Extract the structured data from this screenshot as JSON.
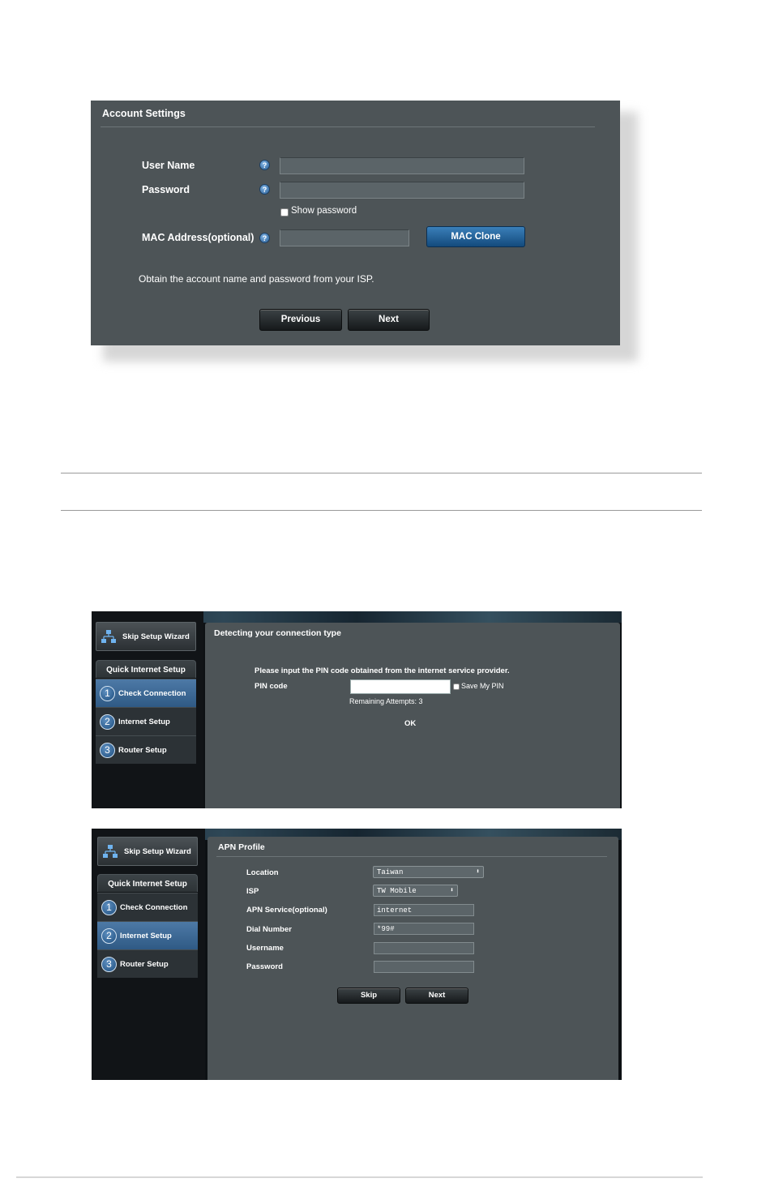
{
  "account_settings": {
    "title": "Account Settings",
    "username_label": "User Name",
    "password_label": "Password",
    "show_password_label": "Show password",
    "mac_label": "MAC Address(optional)",
    "mac_clone_label": "MAC Clone",
    "hint": "Obtain the account name and password from your ISP.",
    "previous_label": "Previous",
    "next_label": "Next",
    "help_glyph": "?"
  },
  "wizard_common": {
    "skip_label": "Skip Setup Wizard",
    "quick_setup_label": "Quick Internet Setup",
    "steps": [
      {
        "num": "1",
        "label": "Check Connection"
      },
      {
        "num": "2",
        "label": "Internet Setup"
      },
      {
        "num": "3",
        "label": "Router Setup"
      }
    ]
  },
  "pin_panel": {
    "title": "Detecting your connection type",
    "instruction": "Please input the PIN code obtained from the internet service provider.",
    "pin_label": "PIN code",
    "save_pin_label": "Save My PIN",
    "remaining": "Remaining Attempts: 3",
    "ok_label": "OK",
    "active_step": 1
  },
  "apn_panel": {
    "title": "APN Profile",
    "location_label": "Location",
    "location_value": "Taiwan",
    "isp_label": "ISP",
    "isp_value": "TW Mobile",
    "apn_label": "APN Service(optional)",
    "apn_value": "internet",
    "dial_label": "Dial Number",
    "dial_value": "*99#",
    "username_label": "Username",
    "password_label": "Password",
    "skip_label": "Skip",
    "next_label": "Next",
    "active_step": 2
  }
}
